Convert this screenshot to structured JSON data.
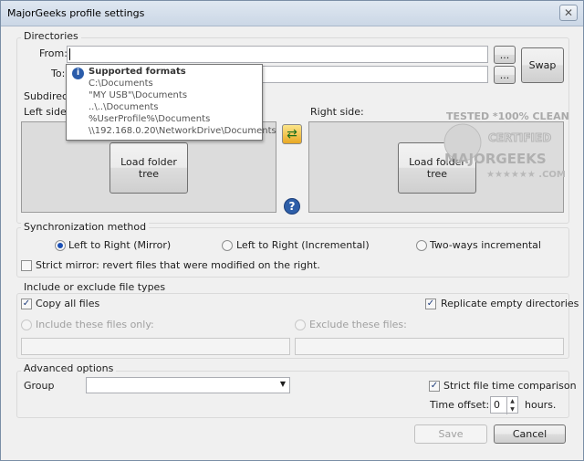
{
  "window": {
    "title": "MajorGeeks profile settings",
    "close": "✕"
  },
  "directories": {
    "label": "Directories",
    "from_label": "From:",
    "from_value": "",
    "to_label": "To:",
    "to_value": "",
    "browse": "...",
    "swap": "Swap"
  },
  "tooltip": {
    "title": "Supported formats",
    "lines": [
      "C:\\Documents",
      "\"MY USB\"\\Documents",
      "..\\..\\Documents",
      "%UserProfile%\\Documents",
      "\\\\192.168.0.20\\NetworkDrive\\Documents"
    ]
  },
  "subdirs": {
    "label": "Subdirect",
    "left_label": "Left side:",
    "right_label": "Right side:",
    "load_left": "Load folder\ntree",
    "load_right": "Load folder\ntree"
  },
  "watermark": {
    "line1": "TESTED *100% CLEAN",
    "line2": "CERTIFIED",
    "line3": "MAJORGEEKS",
    "line4": "★★★★★★ .COM"
  },
  "sync": {
    "label": "Synchronization method",
    "opt1": "Left to Right (Mirror)",
    "opt2": "Left to Right (Incremental)",
    "opt3": "Two-ways incremental",
    "selected": "opt1",
    "strict": "Strict mirror: revert files that were modified on the right."
  },
  "filetypes": {
    "label": "Include or exclude file types",
    "copy_all": "Copy all files",
    "replicate": "Replicate empty directories",
    "include_only": "Include these files only:",
    "exclude": "Exclude these files:"
  },
  "advanced": {
    "label": "Advanced options",
    "group_label": "Group",
    "group_value": "",
    "strict_time": "Strict file time comparison",
    "offset_label": "Time offset:",
    "offset_value": "0",
    "hours": "hours."
  },
  "footer": {
    "save": "Save",
    "cancel": "Cancel"
  }
}
